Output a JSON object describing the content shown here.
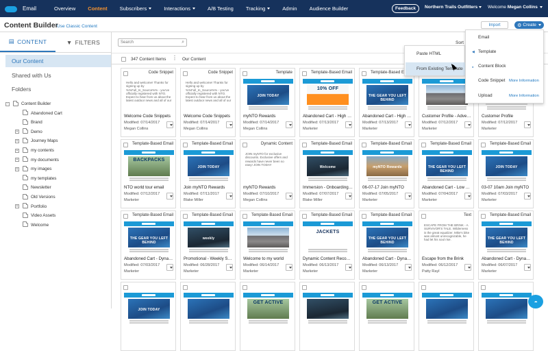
{
  "nav": {
    "app_name": "Email",
    "items": [
      "Overview",
      "Content",
      "Subscribers",
      "Interactions",
      "A/B Testing",
      "Tracking",
      "Admin",
      "Audience Builder"
    ],
    "active": "Content",
    "feedback": "Feedback",
    "org": "Northern Trails Outfitters",
    "welcome_prefix": "Welcome",
    "user": "Megan Collins",
    "accent": "#f59331",
    "bar_color": "#16325c"
  },
  "header": {
    "title": "Content Builder",
    "classic_link": "Use Classic Content",
    "import": "Import",
    "create": "Create"
  },
  "left": {
    "tab_content": "CONTENT",
    "tab_filters": "FILTERS",
    "our_content": "Our Content",
    "shared": "Shared with Us",
    "folders": "Folders",
    "tree": [
      {
        "label": "Content Builder",
        "level": 0,
        "toggle": "-"
      },
      {
        "label": "Abandoned Cart",
        "level": 1,
        "toggle": ""
      },
      {
        "label": "Brand",
        "level": 1,
        "toggle": ""
      },
      {
        "label": "Demo",
        "level": 1,
        "toggle": "+"
      },
      {
        "label": "Journey Maps",
        "level": 1,
        "toggle": "+"
      },
      {
        "label": "my contents",
        "level": 1,
        "toggle": "+"
      },
      {
        "label": "my documents",
        "level": 1,
        "toggle": "+"
      },
      {
        "label": "my images",
        "level": 1,
        "toggle": "+"
      },
      {
        "label": "my templates",
        "level": 1,
        "toggle": ""
      },
      {
        "label": "Newsletter",
        "level": 1,
        "toggle": ""
      },
      {
        "label": "Old Versions",
        "level": 1,
        "toggle": ""
      },
      {
        "label": "Portfolio",
        "level": 1,
        "toggle": "+"
      },
      {
        "label": "Video Assets",
        "level": 1,
        "toggle": ""
      },
      {
        "label": "Welcome",
        "level": 1,
        "toggle": ""
      }
    ]
  },
  "list": {
    "search_placeholder": "Search",
    "count": "347 Content Items",
    "location": "Our Content",
    "sort": "Sort B"
  },
  "cards": [
    {
      "type": "Code Snippet",
      "name": "Welcome Code Snippets",
      "date": "Modified: 07/14/2017",
      "owner": "Megan Collins",
      "thumb": "text",
      "thumb_text": "Hello and welcome! Thanks for signing up by %%Full_In_Source%% - you've officially registered with NTO. Expect to hear from us about the latest outdoor news and all of our"
    },
    {
      "type": "Code Snippet",
      "name": "Welcome Code Snippets",
      "date": "Modified: 07/14/2017",
      "owner": "Megan Collins",
      "thumb": "text",
      "thumb_text": "Hello and welcome! Thanks for signing up by %%Full_In_Source%% - you've officially registered with NTO. Expect to hear from us about the latest outdoor news and all of our"
    },
    {
      "type": "Template",
      "name": "myNTO Rewards",
      "date": "Modified: 07/14/2017",
      "owner": "Megan Collins",
      "thumb": "mail",
      "img": "i-blue",
      "cap": "JOIN TODAY"
    },
    {
      "type": "Template-Based Email",
      "name": "Abandoned Cart - High V...",
      "date": "Modified: 07/13/2017",
      "owner": "Marketer",
      "thumb": "mail",
      "img": "i-orange",
      "cap": "10% OFF"
    },
    {
      "type": "Template-Based Email",
      "name": "Abandoned Cart - High V...",
      "date": "Modified: 07/13/2017",
      "owner": "Marketer",
      "thumb": "mail",
      "img": "i-blue",
      "cap": "THE GEAR YOU LEFT BEHIND"
    },
    {
      "type": "Template-Based Email",
      "name": "Customer Profile - Advent...",
      "date": "Modified: 07/12/2017",
      "owner": "Marketer",
      "thumb": "mail",
      "img": "i-mtn",
      "cap": ""
    },
    {
      "type": "Template-Based Email",
      "name": "Customer Profile",
      "date": "Modified: 07/12/2017",
      "owner": "Marketer",
      "thumb": "mail",
      "img": "i-boot",
      "cap": ""
    },
    {
      "type": "Template-Based Email",
      "name": "NTO world tour email",
      "date": "Modified: 07/12/2017",
      "owner": "Marketer",
      "thumb": "mail",
      "img": "i-green",
      "cap": "BACKPACKS"
    },
    {
      "type": "Template-Based Email",
      "name": "Join myNTO Rewards",
      "date": "Modified: 07/11/2017",
      "owner": "Blake Miller",
      "thumb": "mail",
      "img": "i-blue",
      "cap": "JOIN TODAY"
    },
    {
      "type": "Dynamic Content",
      "name": "myNTO Rewards",
      "date": "Modified: 07/10/2017",
      "owner": "Megan Collins",
      "thumb": "text",
      "thumb_text": "JOIN myNTO for exclusive discounts. Exclusive offers and rewards have never been so easy! JOIN TODAY"
    },
    {
      "type": "Template-Based Email",
      "name": "Immersion - Onboarding ...",
      "date": "Modified: 07/07/2017",
      "owner": "Blake Miller",
      "thumb": "mail",
      "img": "i-dark",
      "cap": "Welcome"
    },
    {
      "type": "Template-Based Email",
      "name": "06-07-17 Join myNTO",
      "date": "Modified: 07/05/2017",
      "owner": "Marketer",
      "thumb": "mail",
      "img": "i-canyon",
      "cap": "myNTO Rewards"
    },
    {
      "type": "Template-Based Email",
      "name": "Abandoned Cart - Low Va...",
      "date": "Modified: 07/04/2017",
      "owner": "Marketer",
      "thumb": "mail",
      "img": "i-blue",
      "cap": "THE GEAR YOU LEFT BEHIND"
    },
    {
      "type": "Template-Based Email",
      "name": "03-07 10am Join myNTO",
      "date": "Modified: 07/03/2017",
      "owner": "Marketer",
      "thumb": "mail",
      "img": "i-blue",
      "cap": "JOIN TODAY"
    },
    {
      "type": "Template-Based Email",
      "name": "Abandoned Cart - Dynami...",
      "date": "Modified: 07/03/2017",
      "owner": "Marketer",
      "thumb": "mail",
      "img": "i-blue",
      "cap": "THE GEAR YOU LEFT BEHIND"
    },
    {
      "type": "Template-Based Email",
      "name": "Promotional - Weekly Sal...",
      "date": "Modified: 06/28/2017",
      "owner": "Marketer",
      "thumb": "mail",
      "img": "i-dark",
      "cap": "weekly"
    },
    {
      "type": "Template-Based Email",
      "name": "Welcome to my world",
      "date": "Modified: 06/14/2017",
      "owner": "Marketer",
      "thumb": "mail",
      "img": "i-mtn",
      "cap": ""
    },
    {
      "type": "Template-Based Email",
      "name": "Dynamic Content Recom...",
      "date": "Modified: 06/13/2017",
      "owner": "Marketer",
      "thumb": "mail",
      "img": "i-jacket",
      "cap": "JACKETS"
    },
    {
      "type": "Template-Based Email",
      "name": "Abandoned Cart - Dynami...",
      "date": "Modified: 06/13/2017",
      "owner": "Marketer",
      "thumb": "mail",
      "img": "i-blue",
      "cap": "THE GEAR YOU LEFT BEHIND"
    },
    {
      "type": "Text",
      "name": "Escape from the Brink",
      "date": "Modified: 06/12/2017",
      "owner": "Patty Rayl",
      "thumb": "text",
      "thumb_text": "ESCAPE FROM THE BRINK - A SURVIVOR'S TALE. Wilderness is the great equalizer. Mike's bike was almost unrecognizable, he had let his soul rise."
    },
    {
      "type": "Template-Based Email",
      "name": "Abandoned Cart - Dynami...",
      "date": "Modified: 06/07/2017",
      "owner": "Marketer",
      "thumb": "mail",
      "img": "i-blue",
      "cap": "THE GEAR YOU LEFT BEHIND"
    },
    {
      "type": "",
      "name": "",
      "date": "",
      "owner": "",
      "thumb": "mail",
      "img": "i-blue",
      "cap": "JOIN TODAY"
    },
    {
      "type": "",
      "name": "",
      "date": "",
      "owner": "",
      "thumb": "mail",
      "img": "i-blue",
      "cap": ""
    },
    {
      "type": "",
      "name": "",
      "date": "",
      "owner": "",
      "thumb": "mail",
      "img": "i-green",
      "cap": "GET ACTIVE"
    },
    {
      "type": "",
      "name": "",
      "date": "",
      "owner": "",
      "thumb": "mail",
      "img": "i-dark",
      "cap": ""
    },
    {
      "type": "",
      "name": "",
      "date": "",
      "owner": "",
      "thumb": "mail",
      "img": "i-green",
      "cap": "GET ACTIVE"
    },
    {
      "type": "",
      "name": "",
      "date": "",
      "owner": "",
      "thumb": "mail",
      "img": "i-blue",
      "cap": ""
    },
    {
      "type": "",
      "name": "",
      "date": "",
      "owner": "",
      "thumb": "mail",
      "img": "i-blue",
      "cap": ""
    }
  ],
  "create_menu": {
    "items": [
      "Email",
      "Template",
      "Content Block",
      "Code Snippet",
      "Upload"
    ],
    "more_info": "More Information"
  },
  "submenu": {
    "items": [
      "Paste HTML",
      "From Existing Template"
    ]
  }
}
